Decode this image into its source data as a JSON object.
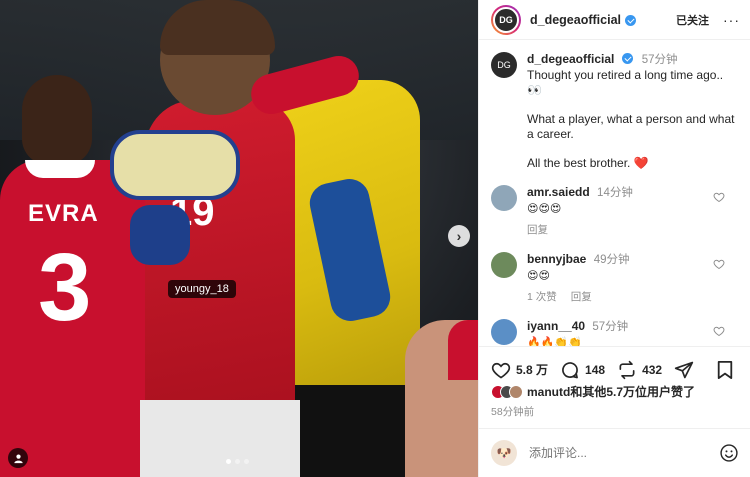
{
  "photo": {
    "jersey_name": "EVRA",
    "jersey_number_left": "3",
    "jersey_number_center": "19",
    "tag_label": "youngy_18",
    "next_arrow": "›",
    "carousel": {
      "slides": 3,
      "active_index": 0
    }
  },
  "header": {
    "username": "d_degeaofficial",
    "follow_label": "已关注",
    "more_label": "···",
    "avatar_initials": "DG"
  },
  "caption": {
    "username": "d_degeaofficial",
    "time": "57分钟",
    "lines": [
      "Thought you retired a long time ago..",
      "👀"
    ],
    "line2": "What a player, what a person and what a career.",
    "line3_text": "All the best brother.",
    "line3_heart": "❤️"
  },
  "comments": [
    {
      "user": "amr.saiedd",
      "time": "14分钟",
      "text": "😍😍😍",
      "reply_label": "回复",
      "likes_label": ""
    },
    {
      "user": "bennyjbae",
      "time": "49分钟",
      "text": "😍😍",
      "likes_label": "1 次赞",
      "reply_label": "回复"
    },
    {
      "user": "iyann__40",
      "time": "57分钟",
      "text": "🔥🔥👏👏"
    }
  ],
  "actions": {
    "like_count": "5.8 万",
    "comment_count": "148",
    "share_count": "432"
  },
  "likes": {
    "text": "manutd和其他5.7万位用户赞了"
  },
  "posted_ago": "58分钟前",
  "add_comment": {
    "placeholder": "添加评论..."
  },
  "colors": {
    "verified": "#3897f0",
    "heart": "#e0245e",
    "united_red": "#c8102e",
    "gk_yellow": "#f1d31a"
  },
  "icons": [
    "heart-icon",
    "comment-icon",
    "share-icon",
    "send-icon",
    "bookmark-icon",
    "emoji-icon",
    "user-tag-icon",
    "chevron-right-icon",
    "verified-badge-icon",
    "more-icon"
  ]
}
